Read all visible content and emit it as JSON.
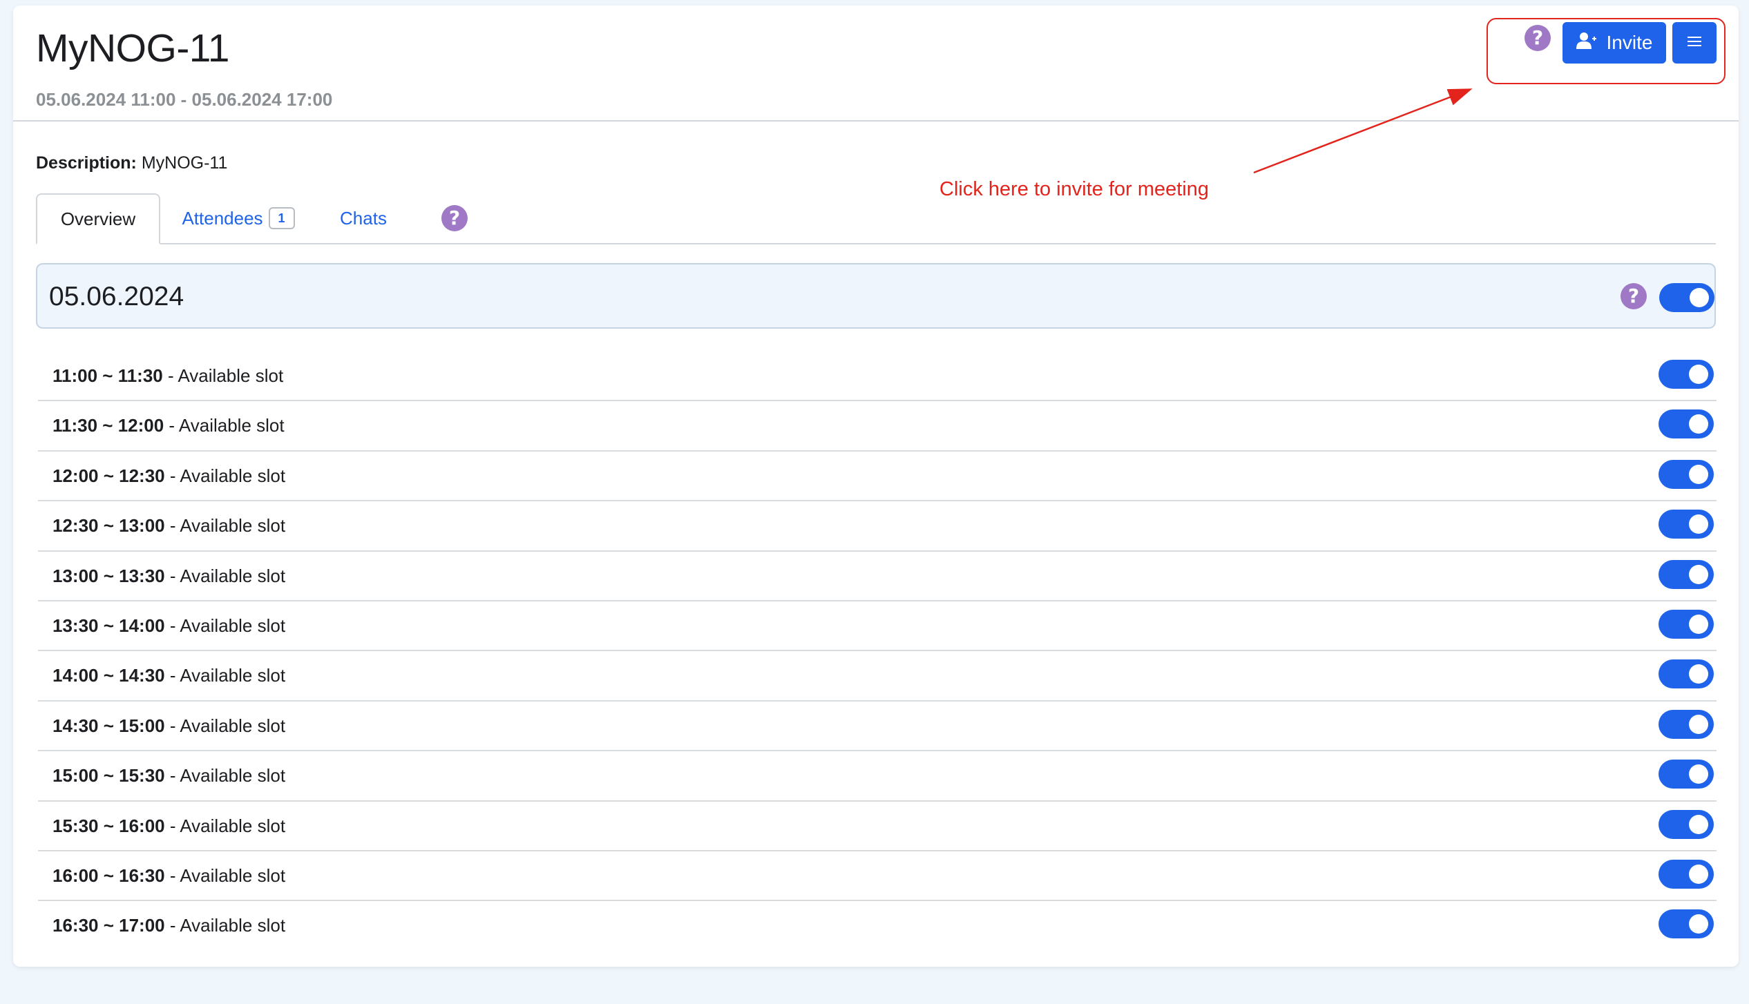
{
  "header": {
    "title": "MyNOG-11",
    "date_range": "05.06.2024 11:00 - 05.06.2024 17:00",
    "invite_label": "Invite",
    "help_glyph": "?"
  },
  "annotation": {
    "text": "Click here to invite for meeting",
    "color": "#e3241d"
  },
  "description": {
    "label": "Description:",
    "value": "MyNOG-11"
  },
  "tabs": [
    {
      "label": "Overview",
      "active": true
    },
    {
      "label": "Attendees",
      "badge": "1"
    },
    {
      "label": "Chats"
    }
  ],
  "day": {
    "date": "05.06.2024",
    "enabled": true
  },
  "slots": [
    {
      "time": "11:00 ~ 11:30",
      "status": "Available slot",
      "enabled": true
    },
    {
      "time": "11:30 ~ 12:00",
      "status": "Available slot",
      "enabled": true
    },
    {
      "time": "12:00 ~ 12:30",
      "status": "Available slot",
      "enabled": true
    },
    {
      "time": "12:30 ~ 13:00",
      "status": "Available slot",
      "enabled": true
    },
    {
      "time": "13:00 ~ 13:30",
      "status": "Available slot",
      "enabled": true
    },
    {
      "time": "13:30 ~ 14:00",
      "status": "Available slot",
      "enabled": true
    },
    {
      "time": "14:00 ~ 14:30",
      "status": "Available slot",
      "enabled": true
    },
    {
      "time": "14:30 ~ 15:00",
      "status": "Available slot",
      "enabled": true
    },
    {
      "time": "15:00 ~ 15:30",
      "status": "Available slot",
      "enabled": true
    },
    {
      "time": "15:30 ~ 16:00",
      "status": "Available slot",
      "enabled": true
    },
    {
      "time": "16:00 ~ 16:30",
      "status": "Available slot",
      "enabled": true
    },
    {
      "time": "16:30 ~ 17:00",
      "status": "Available slot",
      "enabled": true
    }
  ],
  "colors": {
    "primary": "#1e63e9",
    "help": "#9f78c6",
    "background": "#eff6fc"
  },
  "icons": {
    "help": "question-circle-icon",
    "invite": "user-plus-icon",
    "menu": "hamburger-menu-icon"
  }
}
